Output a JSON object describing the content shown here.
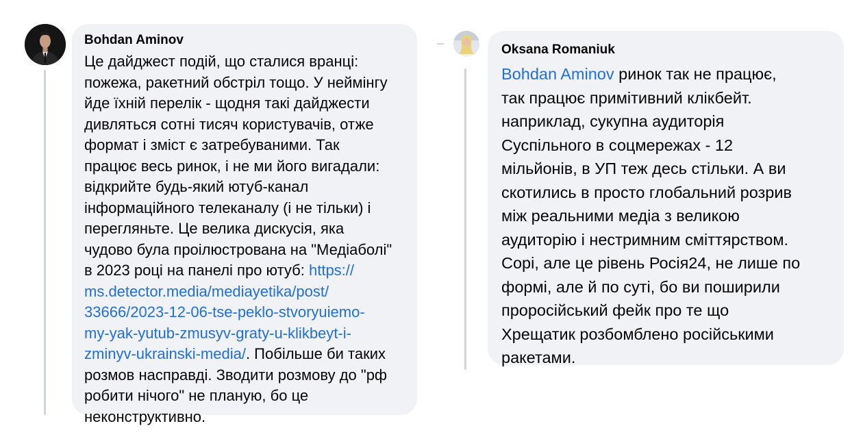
{
  "comments": [
    {
      "author": "Bohdan Aminov",
      "lines": [
        "Це дайджест подій, що сталися вранці:",
        "пожежа, ракетний обстріл тощо. У неймінгу",
        "йде їхній перелік - щодня такі дайджести",
        "дивляться сотні тисяч користувачів, отже",
        "формат і зміст є затребуваними. Так",
        "працює весь ринок, і не ми його вигадали:",
        "відкрийте будь-який ютуб-канал",
        "інформаційного телеканалу (і не тільки) і",
        "перегляньте. Це велика дискусія, яка",
        "чудово була проілюстрована на \"Медіаболі\"",
        "в 2023 році на панелі про ютуб: "
      ],
      "link_lines": [
        "https://",
        "ms.detector.media/mediayetika/post/",
        "33666/2023-12-06-tse-peklo-stvoryuiemo-",
        "my-yak-yutub-zmusyv-graty-u-klikbeyt-i-",
        "zminyv-ukrainski-media/"
      ],
      "after_link": ". Побільше би таких",
      "tail_lines": [
        "розмов насправді. Зводити розмову до \"рф",
        "робити нічого\" не планую, бо це",
        "неконструктивно."
      ]
    },
    {
      "author": "Oksana Romaniuk",
      "mention": "Bohdan Aminov",
      "first_line_rest": " ринок так не працює,",
      "lines": [
        "так працює примітивний клікбейт.",
        "наприклад, сукупна аудиторія",
        "Суспільного в соцмережах - 12",
        "мільйонів, в УП теж десь стільки. А ви",
        "скотились в просто глобальний розрив",
        "між реальними медіа з великою",
        "аудиторію і нестримним сміттярством.",
        "Сорі, але це рівень Росія24, не лише по",
        "формі, але й по суті, бо ви поширили",
        "проросійський фейк про те що",
        "Хрещатик розбомблено російськими",
        "ракетами."
      ]
    }
  ],
  "colors": {
    "bubble": "#f0f2f5",
    "link": "#216fdb",
    "text": "#050505",
    "thread_line": "#d2d4d8"
  }
}
